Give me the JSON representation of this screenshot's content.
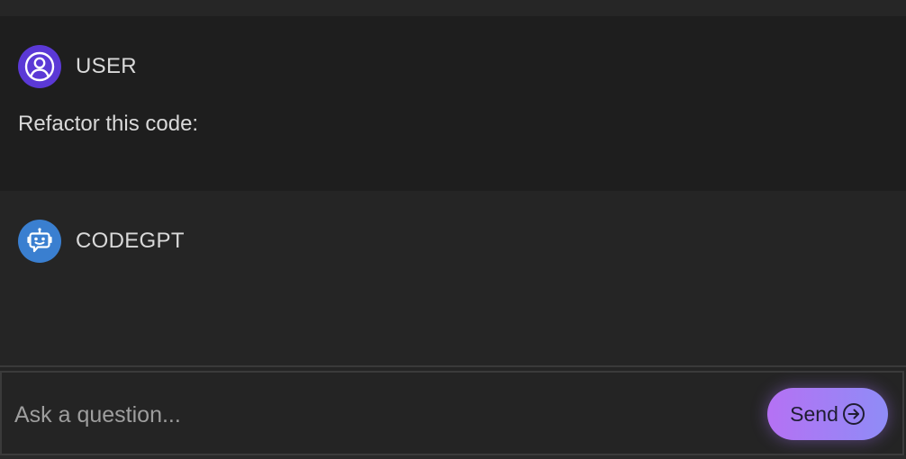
{
  "messages": {
    "user": {
      "author": "USER",
      "text": "Refactor this code:",
      "avatar_icon": "user-circle-icon",
      "avatar_color": "#5b39d6"
    },
    "bot": {
      "author": "CODEGPT",
      "text": "",
      "avatar_icon": "robot-chat-icon",
      "avatar_color": "#3a7fd0"
    }
  },
  "input": {
    "value": "",
    "placeholder": "Ask a question..."
  },
  "send": {
    "label": "Send",
    "icon": "arrow-right-circle-icon",
    "gradient_start": "#b571f4",
    "gradient_end": "#8f8cf6"
  }
}
